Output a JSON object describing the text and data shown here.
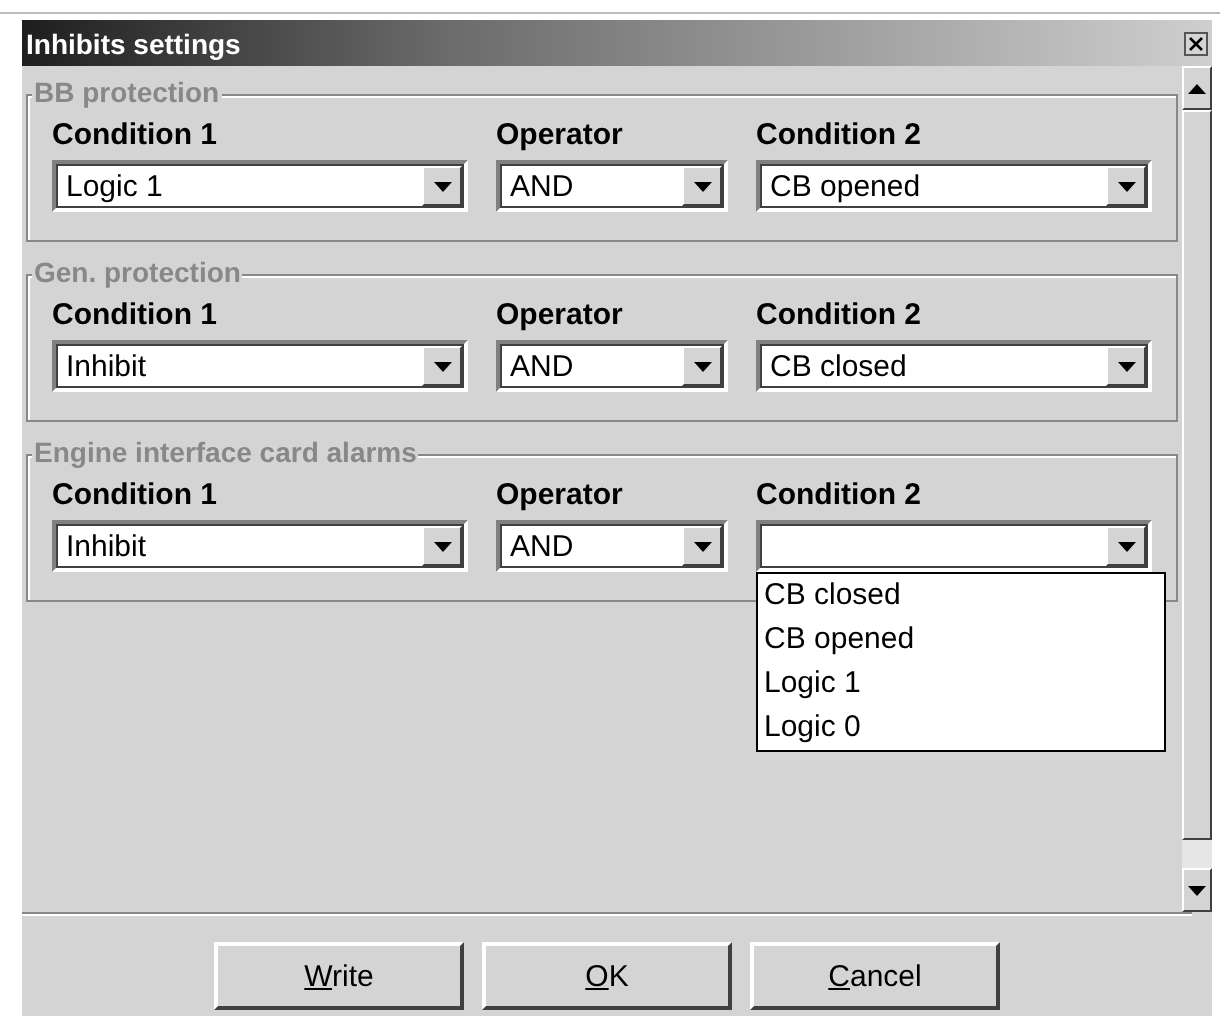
{
  "window": {
    "title": "Inhibits settings"
  },
  "groups": [
    {
      "title": "BB protection",
      "labels": [
        "Condition 1",
        "Operator",
        "Condition 2"
      ],
      "combos": [
        {
          "value": "Logic 1",
          "expanded": false
        },
        {
          "value": "AND",
          "expanded": false
        },
        {
          "value": "CB opened",
          "expanded": false
        }
      ]
    },
    {
      "title": "Gen. protection",
      "labels": [
        "Condition 1",
        "Operator",
        "Condition 2"
      ],
      "combos": [
        {
          "value": "Inhibit",
          "expanded": false
        },
        {
          "value": "AND",
          "expanded": false
        },
        {
          "value": "CB closed",
          "expanded": false
        }
      ]
    },
    {
      "title": "Engine interface card alarms",
      "labels": [
        "Condition 1",
        "Operator",
        "Condition 2"
      ],
      "combos": [
        {
          "value": "Inhibit",
          "expanded": false
        },
        {
          "value": "AND",
          "expanded": false
        },
        {
          "expanded": true,
          "options": [
            "CB closed",
            "CB opened",
            "Logic 1",
            "Logic 0"
          ]
        }
      ]
    }
  ],
  "buttons": [
    {
      "label": "Write",
      "mnemonic": true
    },
    {
      "label": "OK",
      "mnemonic": true
    },
    {
      "label": "Cancel",
      "mnemonic": true
    }
  ]
}
